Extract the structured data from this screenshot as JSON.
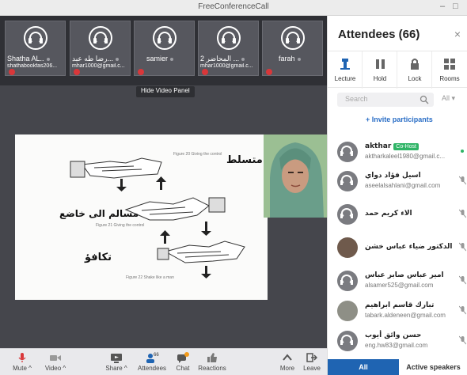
{
  "window": {
    "title": "FreeConferenceCall",
    "minimize": "–",
    "maximize": "□"
  },
  "thumbnails": [
    {
      "name": "Shatha AL..",
      "email": "shathabookfas206..."
    },
    {
      "name": "رضا طه عبد...",
      "email": "mhar1000@gmail.c..."
    },
    {
      "name": "samier",
      "email": ""
    },
    {
      "name": "المحاضر 2 ...",
      "email": "mhar1000@gmail.c..."
    },
    {
      "name": "farah",
      "email": ""
    }
  ],
  "hide_video_panel": "Hide Video Panel",
  "slide": {
    "labels": [
      "متسلط",
      "مسالم الى خاضع",
      "تكافؤ"
    ],
    "captions": [
      "Figure 20   Giving the control",
      "Figure 21   Giving the control",
      "Figure 22   Shake like a man"
    ]
  },
  "toolbar": {
    "mute": "Mute",
    "video": "Video",
    "share": "Share",
    "attendees": "Attendees",
    "attendees_count": "66",
    "chat": "Chat",
    "chat_badge": "23",
    "reactions": "Reactions",
    "more": "More",
    "leave": "Leave"
  },
  "panel": {
    "title": "Attendees (66)",
    "close": "×",
    "tools": [
      "Lecture",
      "Hold",
      "Lock",
      "Rooms"
    ],
    "search_placeholder": "Search",
    "filter": "All",
    "invite": "+ Invite participants",
    "attendees": [
      {
        "name": "akthar",
        "badge": "Co-Host",
        "email": "aktharkaleel1980@gmail.c..."
      },
      {
        "name": "اسيل فؤاد دواي",
        "email": "aseelalsahlani@gmail.com"
      },
      {
        "name": "الاء كريم حمد",
        "email": ""
      },
      {
        "name": "الدكتور ضياء عباس خشن",
        "email": ""
      },
      {
        "name": "امير عباس صابر عباس",
        "email": "alsamer525@gmail.com"
      },
      {
        "name": "تبارك قاسم ابراهيم",
        "email": "tabark.aldeneen@gmail.com"
      },
      {
        "name": "حسن وائق أيوب",
        "email": "eng.hw83@gmail.com"
      }
    ],
    "tabs": {
      "all": "All",
      "active": "Active speakers"
    }
  },
  "colors": {
    "accent": "#1f64b2",
    "cohost": "#2fb466",
    "mute_red": "#d9373a"
  }
}
